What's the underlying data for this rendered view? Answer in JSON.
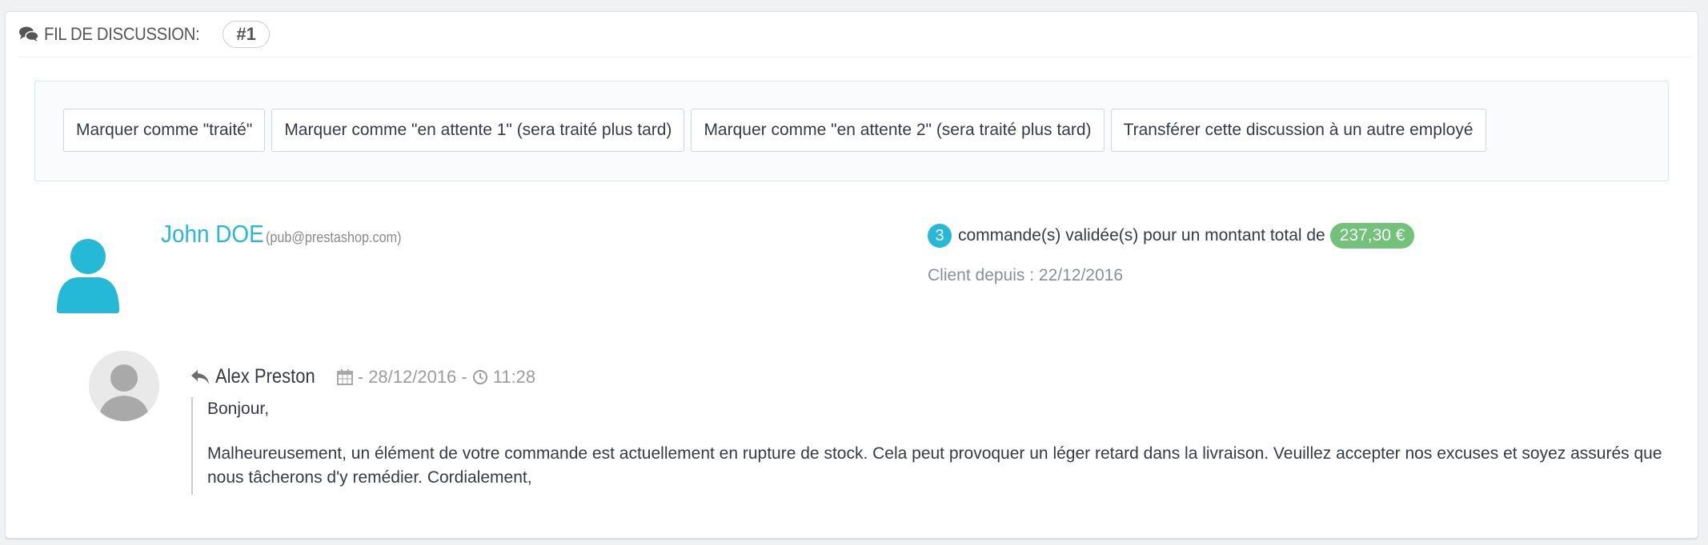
{
  "panel": {
    "title": "FIL DE DISCUSSION:",
    "thread_number": "#1",
    "heading_icon": "comments-icon"
  },
  "actions": [
    {
      "label": "Marquer comme \"traité\""
    },
    {
      "label": "Marquer comme \"en attente 1\" (sera traité plus tard)"
    },
    {
      "label": "Marquer comme \"en attente 2\" (sera traité plus tard)"
    },
    {
      "label": "Transférer cette discussion à un autre employé"
    }
  ],
  "customer": {
    "name": "John DOE",
    "email": "(pub@prestashop.com)",
    "avatar_icon": "user-icon",
    "orders_count": "3",
    "orders_text": "commande(s) validée(s) pour un montant total de",
    "total_amount": "237,30 €",
    "client_since": "Client depuis : 22/12/2016"
  },
  "message": {
    "reply_icon": "reply-icon",
    "author": "Alex Preston",
    "calendar_icon": "calendar-icon",
    "date_text": "- 28/12/2016 -",
    "clock_icon": "clock-icon",
    "time": "11:28",
    "greeting": "Bonjour,",
    "body": "Malheureusement, un élément de votre commande est actuellement en rupture de stock. Cela peut provoquer un léger retard dans la livraison. Veuillez accepter nos excuses et soyez assurés que nous tâcherons d'y remédier. Cordialement,"
  },
  "colors": {
    "accent": "#25b9d7",
    "success": "#72c279",
    "text": "#363a41",
    "muted": "#8a8f94"
  }
}
